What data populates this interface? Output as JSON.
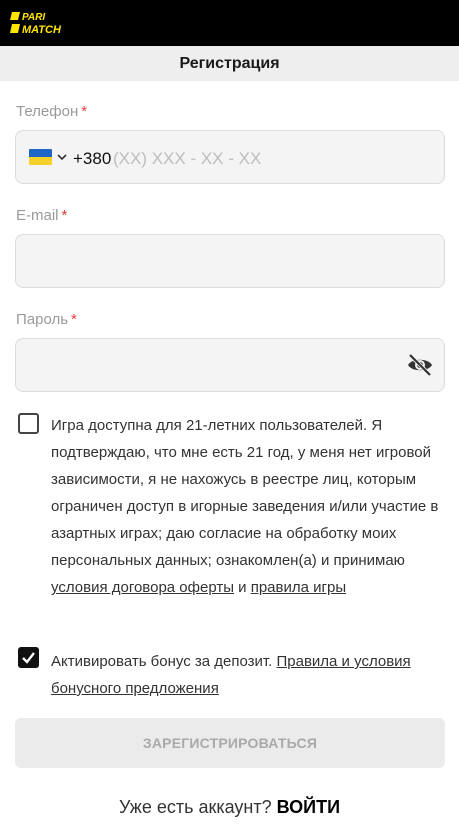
{
  "brand": {
    "logo_line1": "PARI",
    "logo_line2": "MATCH",
    "logo_color": "#ffe600"
  },
  "page": {
    "title": "Регистрация"
  },
  "phone": {
    "label": "Телефон",
    "required_mark": "*",
    "country_flag": "ukraine-flag",
    "prefix": "+380",
    "placeholder_mask": "(XX) XXX - XX - XX"
  },
  "email": {
    "label": "E-mail",
    "required_mark": "*",
    "value": ""
  },
  "password": {
    "label": "Пароль",
    "required_mark": "*",
    "value": "",
    "toggle_icon": "eye-off-icon"
  },
  "terms": {
    "checked": false,
    "text": "Игра доступна для 21-летних пользователей. Я подтверждаю, что мне есть 21 год, у меня нет игровой зависимости, я не нахожусь в реестре лиц, которым ограничен доступ в игорные заведения и/или участие в азартных играх; даю согласие на обработку моих персональных данных; ознакомлен(а) и принимаю ",
    "link1": "условия договора оферты",
    "and": " и ",
    "link2": "правила игры"
  },
  "bonus": {
    "checked": true,
    "text": "Активировать бонус за депозит. ",
    "link": "Правила и условия бонусного предложения"
  },
  "submit_label": "ЗАРЕГИСТРИРОВАТЬСЯ",
  "login": {
    "prompt": "Уже есть аккаунт? ",
    "link": "ВОЙТИ"
  }
}
